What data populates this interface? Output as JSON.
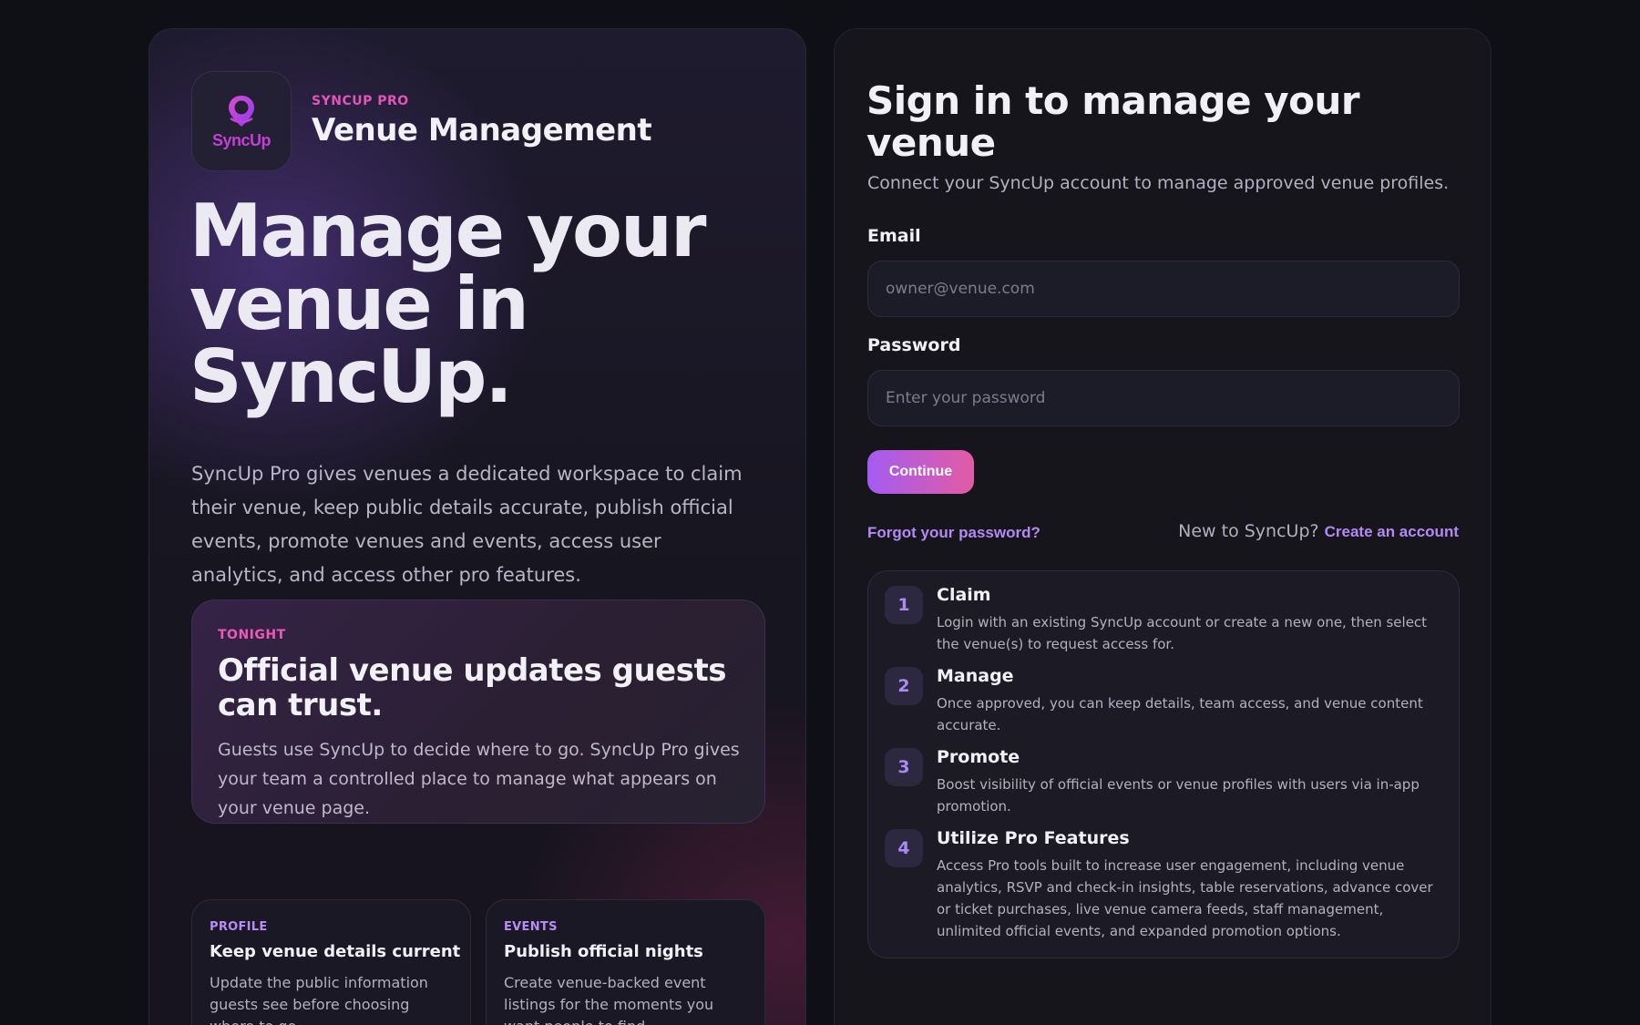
{
  "brand": {
    "logo_text": "SyncUp",
    "kicker": "SYNCUP PRO",
    "title": "Venue Management"
  },
  "hero": {
    "title": "Manage your venue in SyncUp.",
    "description": "SyncUp Pro gives venues a dedicated workspace to claim their venue, keep public details accurate, publish official events, promote venues and events, access user analytics, and access other pro features."
  },
  "feature": {
    "kicker": "TONIGHT",
    "title": "Official venue updates guests can trust.",
    "body": "Guests use SyncUp to decide where to go. SyncUp Pro gives your team a controlled place to manage what appears on your venue page."
  },
  "cards": [
    {
      "kicker": "PROFILE",
      "title": "Keep venue details current",
      "body": "Update the public information guests see before choosing where to go."
    },
    {
      "kicker": "EVENTS",
      "title": "Publish official nights",
      "body": "Create venue-backed event listings for the moments you want people to find."
    }
  ],
  "signin": {
    "title": "Sign in to manage your venue",
    "subtitle": "Connect your SyncUp account to manage approved venue profiles.",
    "email_label": "Email",
    "email_placeholder": "owner@venue.com",
    "password_label": "Password",
    "password_placeholder": "Enter your password",
    "continue_label": "Continue",
    "forgot_label": "Forgot your password?",
    "new_text": "New to SyncUp?",
    "create_label": "Create an account"
  },
  "steps": [
    {
      "number": "1",
      "title": "Claim",
      "body": "Login with an existing SyncUp account or create a new one, then select the venue(s) to request access for."
    },
    {
      "number": "2",
      "title": "Manage",
      "body": "Once approved, you can keep details, team access, and venue content accurate."
    },
    {
      "number": "3",
      "title": "Promote",
      "body": "Boost visibility of official events or venue profiles with users via in-app promotion."
    },
    {
      "number": "4",
      "title": "Utilize Pro Features",
      "body": "Access Pro tools built to increase user engagement, including venue analytics, RSVP and check-in insights, table reservations, advance cover or ticket purchases, live venue camera feeds, staff management, unlimited official events, and expanded promotion options."
    }
  ],
  "colors": {
    "accent_purple": "#b38af5",
    "accent_pink": "#e454b8",
    "button_gradient_start": "#a35cf1",
    "button_gradient_end": "#e25ba4"
  }
}
